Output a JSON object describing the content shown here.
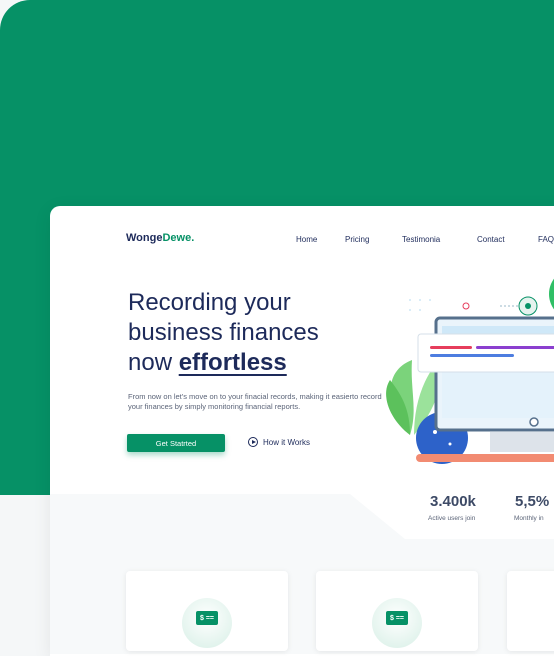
{
  "logo": {
    "main": "Wonge",
    "accent": "Dewe."
  },
  "nav": {
    "items": [
      "Home",
      "Pricing",
      "Testimonia",
      "Contact",
      "FAQ"
    ]
  },
  "hero": {
    "title_line1": "Recording your",
    "title_line2": "business finances",
    "title_line3_pre": "now ",
    "title_line3_em": "effortless",
    "subtitle": "From now on let's move on to your finacial records, making it easierto record your finances by simply monitoring financial reports.",
    "primary_button": "Get Statrted",
    "secondary_button": "How it Works"
  },
  "stats": [
    {
      "value": "3.400k",
      "label": "Active users join"
    },
    {
      "value": "5,5%",
      "label": "Monthly in"
    }
  ],
  "features": [
    {
      "icon": "money-icon",
      "symbol": "$ =="
    },
    {
      "icon": "money-icon",
      "symbol": "$ =="
    }
  ],
  "colors": {
    "brand": "#069166",
    "navy": "#1d2a5a",
    "accent_red": "#e63d5c",
    "accent_purple": "#8b3fcf"
  },
  "illustration": {
    "icons": [
      "monitor-icon",
      "plant-icon",
      "chart-circle-icon"
    ]
  }
}
